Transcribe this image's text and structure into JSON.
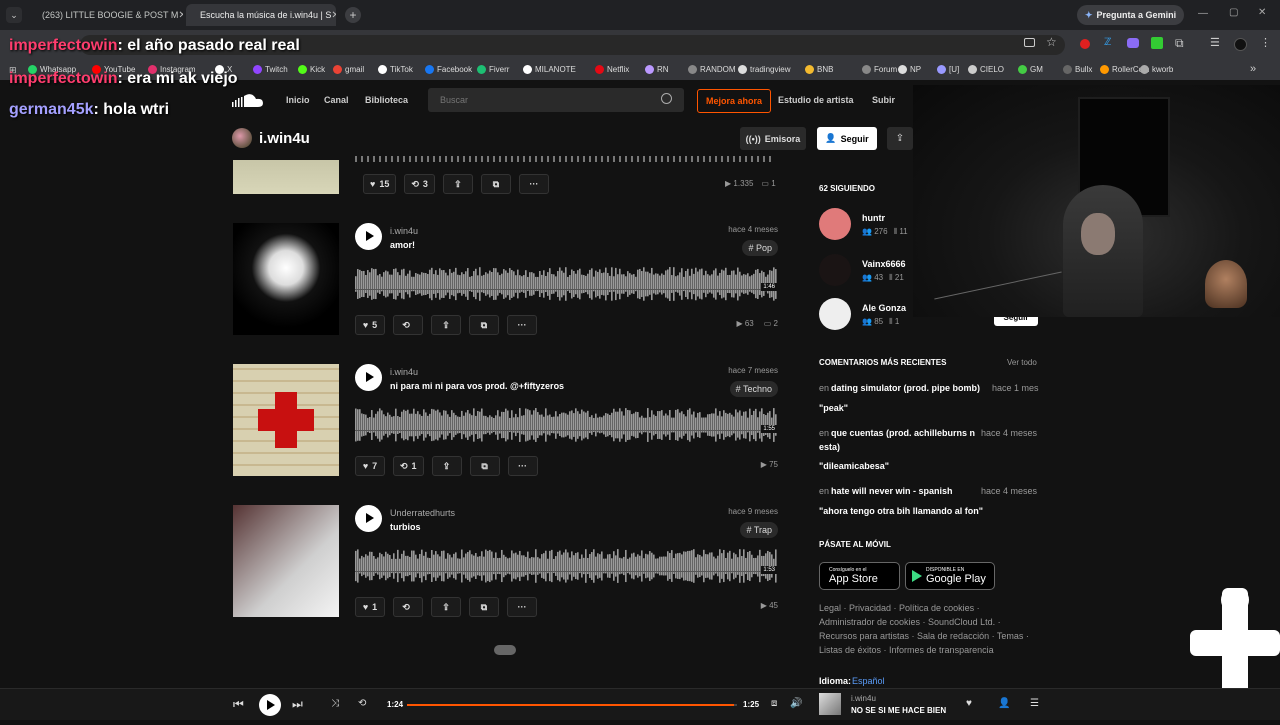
{
  "browser": {
    "tabs": [
      {
        "title": "(263) LITTLE BOOGIE & POST M",
        "active": false
      },
      {
        "title": "Escucha la música de i.win4u | S",
        "active": true
      }
    ],
    "gemini_label": "Pregunta a Gemini",
    "bookmarks": [
      "Whatsapp",
      "YouTube",
      "Instagram",
      "X",
      "Twitch",
      "Kick",
      "gmail",
      "TikTok",
      "Facebook",
      "Fiverr",
      "MILANOTE",
      "Netflix",
      "RN",
      "RANDOM",
      "tradingview",
      "BNB",
      "Forum",
      "NP",
      "[U]",
      "CIELO",
      "GM",
      "Bullx",
      "RollerCoin",
      "kworb"
    ]
  },
  "chat": [
    {
      "user": "imperfectowin",
      "message": ": el año pasado real real",
      "color": "#ff3d6e"
    },
    {
      "user": "imperfectowin",
      "message": ": era mi ak viejo",
      "color": "#ff3d6e"
    },
    {
      "user": "german45k",
      "message": ": hola wtri",
      "color": "#a4a0ff"
    }
  ],
  "nav": {
    "items": [
      "Inicio",
      "Canal",
      "Biblioteca"
    ],
    "search_placeholder": "Buscar",
    "upgrade": "Mejora ahora",
    "studio": "Estudio de artista",
    "upload": "Subir"
  },
  "profile": {
    "name": "i.win4u",
    "station": "Emisora",
    "follow": "Seguir"
  },
  "top_track": {
    "likes": "15",
    "reposts": "3",
    "plays": "1.335",
    "comments": "1"
  },
  "tracks": [
    {
      "artist": "i.win4u",
      "title": "amor!",
      "ago": "hace 4 meses",
      "genre": "# Pop",
      "duration": "1:46",
      "likes": "5",
      "reposts": "",
      "plays": "63",
      "comments": "2"
    },
    {
      "artist": "i.win4u",
      "title": "ni para mi ni para vos prod. @+fiftyzeros",
      "ago": "hace 7 meses",
      "genre": "# Techno",
      "duration": "1:55",
      "likes": "7",
      "reposts": "1",
      "plays": "75",
      "comments": ""
    },
    {
      "artist": "Underratedhurts",
      "title": "turbios",
      "ago": "hace 9 meses",
      "genre": "# Trap",
      "duration": "1:53",
      "likes": "1",
      "reposts": "",
      "plays": "45",
      "comments": ""
    }
  ],
  "sidebar": {
    "following_title": "62 SIGUIENDO",
    "following": [
      {
        "name": "huntr",
        "followers": "276",
        "tracks": "11"
      },
      {
        "name": "Vainx6666",
        "followers": "43",
        "tracks": "21"
      },
      {
        "name": "Ale Gonza",
        "followers": "85",
        "tracks": "1"
      }
    ],
    "follow_btn": "Seguir",
    "comments_title": "COMENTARIOS MÁS RECIENTES",
    "see_all": "Ver todo",
    "comments": [
      {
        "prefix": "en",
        "track": "dating simulator (prod. pipe bomb)",
        "ago": "hace 1 mes",
        "text": "\"peak\""
      },
      {
        "prefix": "en",
        "track": "que cuentas (prod. achilleburns n",
        "track2": "esta)",
        "ago": "hace 4 meses",
        "text": "\"dileamicabesa\""
      },
      {
        "prefix": "en",
        "track": "hate will never win - spanish",
        "ago": "hace 4 meses",
        "text": "\"ahora tengo otra bih llamando al fon\""
      }
    ],
    "mobile_title": "PÁSATE AL MÓVIL",
    "appstore_small": "Consíguelo en el",
    "appstore": "App Store",
    "gplay_small": "DISPONIBLE EN",
    "gplay": "Google Play",
    "footer_lines": [
      "Legal · Privacidad · Política de cookies ·",
      "Administrador de cookies · SoundCloud Ltd. ·",
      "Recursos para artistas · Sala de redacción · Temas ·",
      "Listas de éxitos · Informes de transparencia"
    ],
    "language_label": "Idioma:",
    "language": "Español"
  },
  "player": {
    "elapsed": "1:24",
    "total": "1:25",
    "progress": 0.99,
    "artist": "i.win4u",
    "title": "NO SE SI ME HACE BIEN"
  },
  "colors": {
    "accent": "#ff5500",
    "bg": "#121212"
  }
}
